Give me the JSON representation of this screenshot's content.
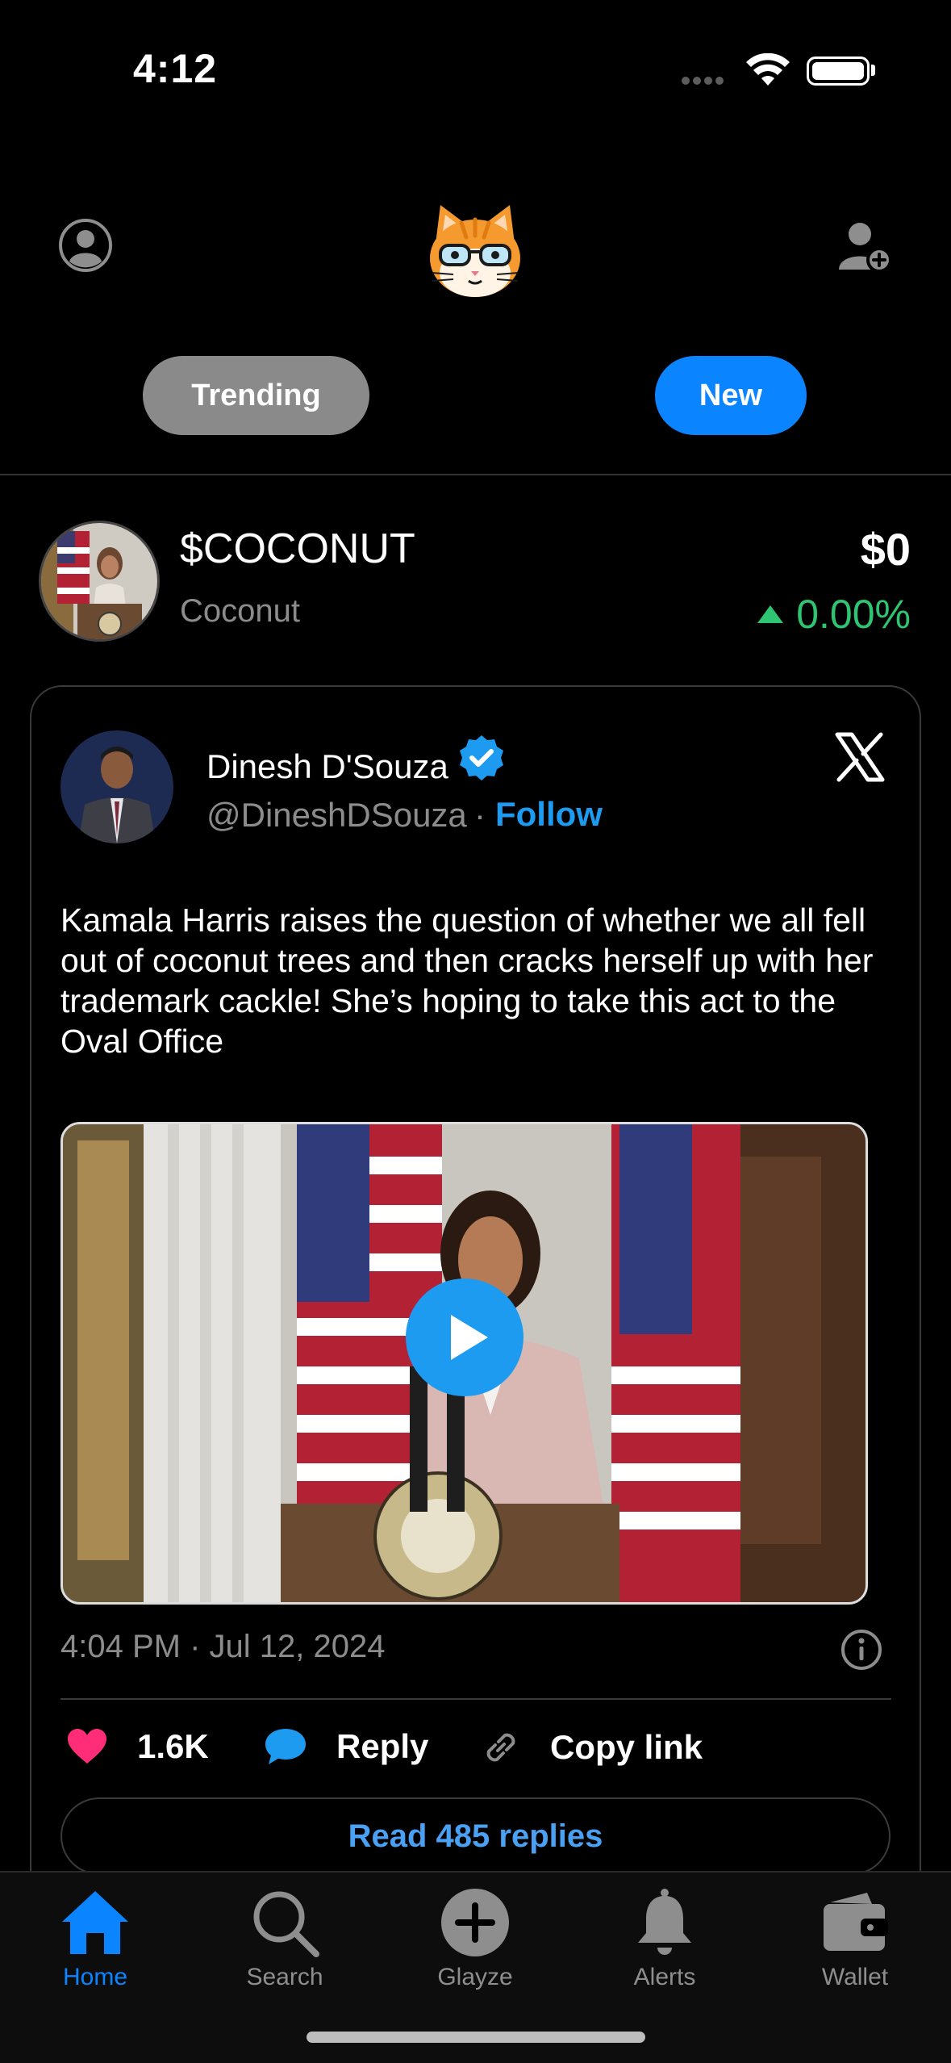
{
  "status_bar": {
    "time": "4:12"
  },
  "tabs": {
    "trending_label": "Trending",
    "new_label": "New",
    "active": "New"
  },
  "token": {
    "symbol": "$COCONUT",
    "name": "Coconut",
    "price": "$0",
    "change": "0.00%",
    "change_direction": "up",
    "change_color": "#2ec472"
  },
  "tweet": {
    "author_name": "Dinesh D'Souza",
    "author_handle": "@DineshDSouza",
    "separator": "·",
    "follow_label": "Follow",
    "verified": true,
    "source_icon": "x-logo-icon",
    "text": "Kamala Harris raises the question of whether we all fell out of coconut trees and then cracks herself up with her trademark cackle! She’s hoping to take this act to the Oval Office",
    "timestamp": "4:04 PM · Jul 12, 2024",
    "likes": "1.6K",
    "reply_label": "Reply",
    "copy_link_label": "Copy link",
    "read_replies_label": "Read 485 replies"
  },
  "nav": {
    "items": [
      {
        "label": "Home",
        "icon": "home-icon",
        "active": true
      },
      {
        "label": "Search",
        "icon": "search-icon",
        "active": false
      },
      {
        "label": "Glayze",
        "icon": "plus-circle-icon",
        "active": false
      },
      {
        "label": "Alerts",
        "icon": "bell-icon",
        "active": false
      },
      {
        "label": "Wallet",
        "icon": "wallet-icon",
        "active": false
      }
    ]
  },
  "colors": {
    "accent": "#0a84ff",
    "link": "#1d9bf0",
    "like": "#ff2d78",
    "muted": "#8c8c8c"
  }
}
